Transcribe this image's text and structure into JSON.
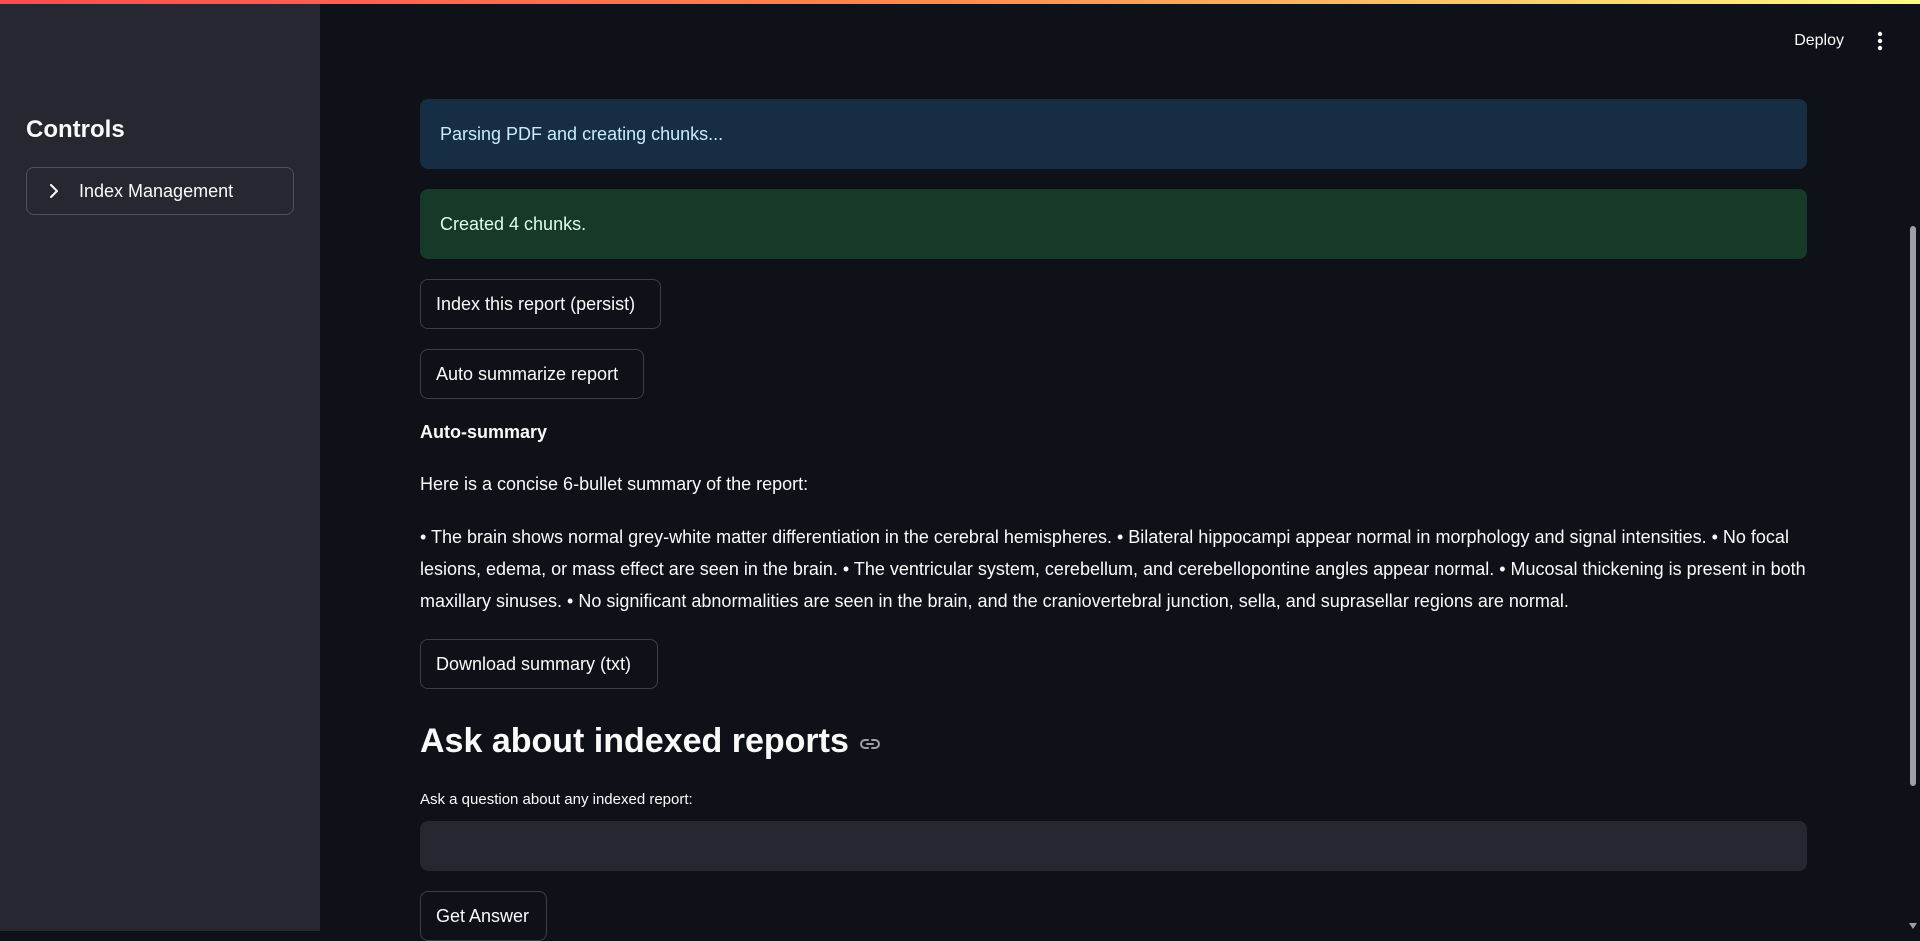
{
  "header": {
    "deploy_label": "Deploy",
    "menu_icon": "vertical-dots-icon"
  },
  "sidebar": {
    "title": "Controls",
    "expander": {
      "label": "Index Management",
      "icon": "chevron-right-icon"
    }
  },
  "main": {
    "info_message": "Parsing PDF and creating chunks...",
    "success_message": "Created 4 chunks.",
    "index_button_label": "Index this report (persist)",
    "summarize_button_label": "Auto summarize report",
    "summary_heading": "Auto-summary",
    "summary_intro": "Here is a concise 6-bullet summary of the report:",
    "summary_text": "• The brain shows normal grey-white matter differentiation in the cerebral hemispheres. • Bilateral hippocampi appear normal in morphology and signal intensities. • No focal lesions, edema, or mass effect are seen in the brain. • The ventricular system, cerebellum, and cerebellopontine angles appear normal. • Mucosal thickening is present in both maxillary sinuses. • No significant abnormalities are seen in the brain, and the craniovertebral junction, sella, and suprasellar regions are normal.",
    "download_button_label": "Download summary (txt)",
    "ask_section_title": "Ask about indexed reports",
    "question_label": "Ask a question about any indexed report:",
    "question_value": "",
    "answer_button_label": "Get Answer"
  },
  "colors": {
    "background": "#0e1117",
    "sidebar_background": "#262730",
    "info_background": "#172d43",
    "info_text": "#c7ebff",
    "success_background": "#173928",
    "success_text": "#dffde9",
    "accent_stripe_start": "#ff4b4b",
    "accent_stripe_end": "#fffd80"
  }
}
